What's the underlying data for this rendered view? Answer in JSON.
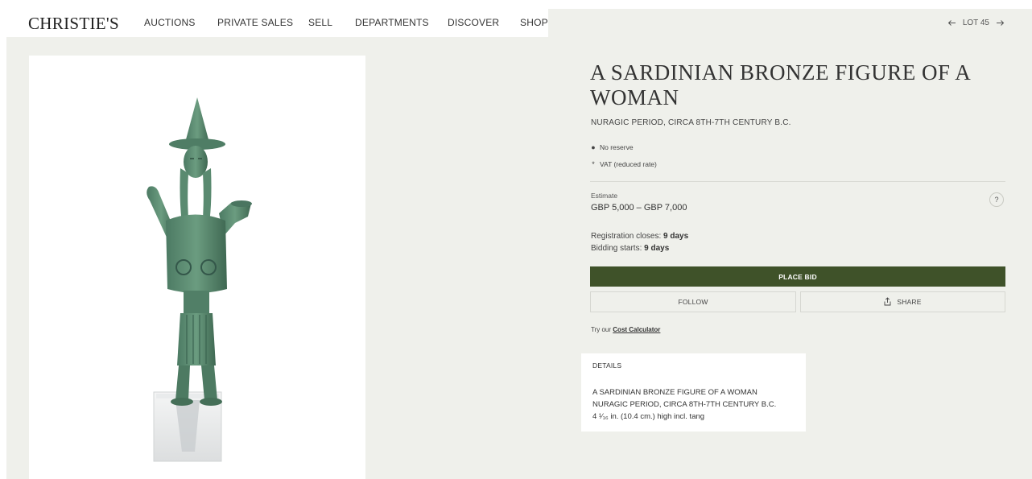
{
  "brand": {
    "logo_text": "CHRISTIE'S"
  },
  "nav": {
    "items": [
      {
        "id": "auctions",
        "label": "AUCTIONS"
      },
      {
        "id": "private-sales",
        "label": "PRIVATE SALES"
      },
      {
        "id": "sell",
        "label": "SELL"
      },
      {
        "id": "departments",
        "label": "DEPARTMENTS"
      },
      {
        "id": "discover",
        "label": "DISCOVER"
      },
      {
        "id": "shop",
        "label": "SHOP"
      }
    ],
    "lot_label": "LOT 45",
    "prev_icon": "arrow-left-icon",
    "next_icon": "arrow-right-icon"
  },
  "lot": {
    "title": "A SARDINIAN BRONZE FIGURE OF A WOMAN",
    "subtitle": "NURAGIC PERIOD, CIRCA 8TH-7TH CENTURY B.C.",
    "notes": [
      {
        "symbol": "●",
        "text": "No reserve"
      },
      {
        "symbol": "*",
        "text": "VAT (reduced rate)"
      }
    ],
    "estimate_label": "Estimate",
    "estimate_value": "GBP 5,000 – GBP 7,000",
    "help_label": "?",
    "registration_label": "Registration closes:",
    "registration_value": "9 days",
    "bidding_label": "Bidding starts:",
    "bidding_value": "9 days"
  },
  "actions": {
    "place_bid": "PLACE BID",
    "follow": "FOLLOW",
    "share": "SHARE",
    "share_icon": "share-icon",
    "cost_prefix": "Try our",
    "cost_link": "Cost Calculator"
  },
  "details": {
    "heading": "DETAILS",
    "lines": [
      "A SARDINIAN BRONZE FIGURE OF A WOMAN",
      "NURAGIC PERIOD, CIRCA 8TH-7TH CENTURY B.C.",
      "4 ¹⁄₁₆ in. (10.4 cm.) high incl. tang"
    ]
  },
  "colors": {
    "page_background": "#eff0eb",
    "accent_green": "#3f5229",
    "bronze_patina": "#5f8e72"
  }
}
